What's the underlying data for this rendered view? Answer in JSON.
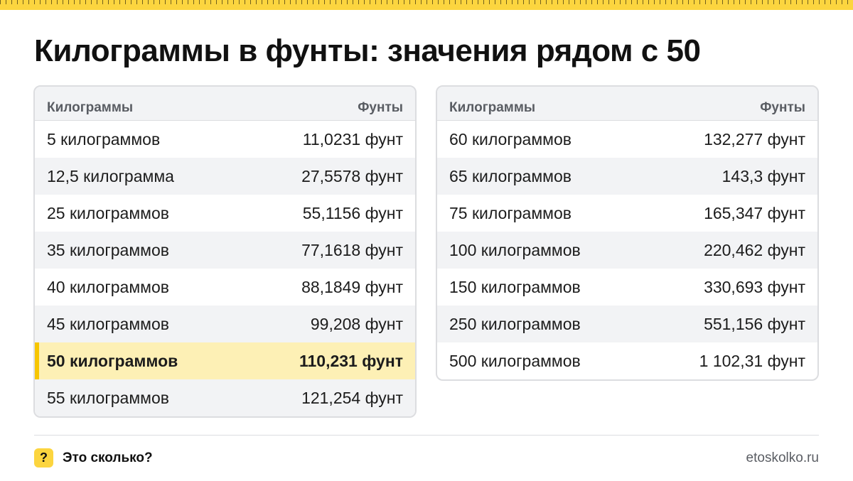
{
  "page": {
    "title": "Килограммы в фунты: значения рядом с 50"
  },
  "colors": {
    "accent": "#fcd53f",
    "highlight_row": "#fdf0b5",
    "stripe": "#f2f3f5",
    "border": "#dcdde0"
  },
  "tables": [
    {
      "headers": {
        "kg": "Килограммы",
        "lb": "Фунты"
      },
      "rows": [
        {
          "kg": "5 килограммов",
          "lb": "11,0231 фунт"
        },
        {
          "kg": "12,5 килограмма",
          "lb": "27,5578 фунт"
        },
        {
          "kg": "25 килограммов",
          "lb": "55,1156 фунт"
        },
        {
          "kg": "35 килограммов",
          "lb": "77,1618 фунт"
        },
        {
          "kg": "40 килограммов",
          "lb": "88,1849 фунт"
        },
        {
          "kg": "45 килограммов",
          "lb": "99,208 фунт"
        },
        {
          "kg": "50 килограммов",
          "lb": "110,231 фунт",
          "highlighted": true
        },
        {
          "kg": "55 килограммов",
          "lb": "121,254 фунт"
        }
      ]
    },
    {
      "headers": {
        "kg": "Килограммы",
        "lb": "Фунты"
      },
      "rows": [
        {
          "kg": "60 килограммов",
          "lb": "132,277 фунт"
        },
        {
          "kg": "65 килограммов",
          "lb": "143,3 фунт"
        },
        {
          "kg": "75 килограммов",
          "lb": "165,347 фунт"
        },
        {
          "kg": "100 килограммов",
          "lb": "220,462 фунт"
        },
        {
          "kg": "150 килограммов",
          "lb": "330,693 фунт"
        },
        {
          "kg": "250 килограммов",
          "lb": "551,156 фунт"
        },
        {
          "kg": "500 килограммов",
          "lb": "1 102,31 фунт"
        }
      ]
    }
  ],
  "footer": {
    "badge_glyph": "?",
    "brand": "Это сколько?",
    "site": "etoskolko.ru"
  }
}
